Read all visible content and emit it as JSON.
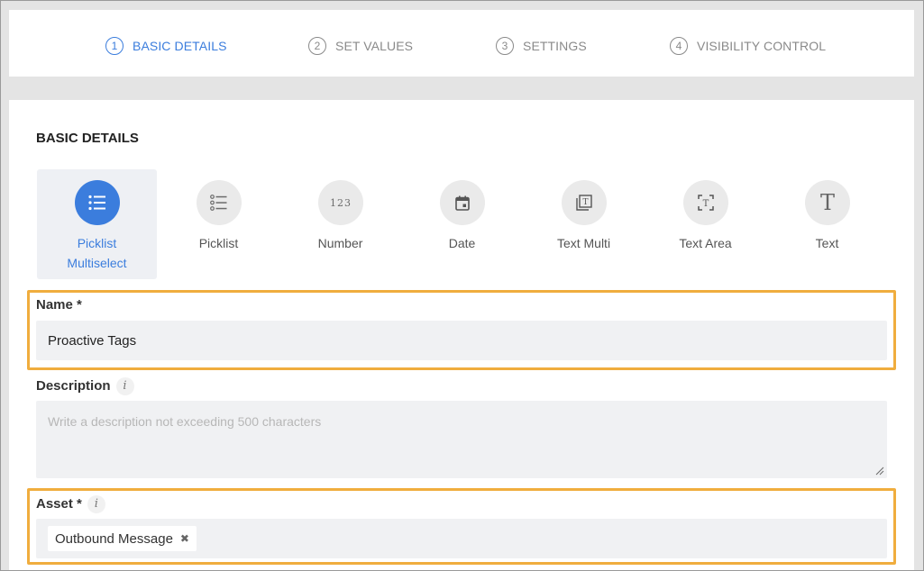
{
  "stepper": {
    "steps": [
      {
        "num": "1",
        "label": "BASIC DETAILS",
        "active": true
      },
      {
        "num": "2",
        "label": "SET VALUES",
        "active": false
      },
      {
        "num": "3",
        "label": "SETTINGS",
        "active": false
      },
      {
        "num": "4",
        "label": "VISIBILITY CONTROL",
        "active": false
      }
    ],
    "accent_color": "#3b7ddd"
  },
  "section": {
    "title": "BASIC DETAILS"
  },
  "field_types": [
    {
      "label_line1": "Picklist",
      "label_line2": "Multiselect",
      "icon": "list-bullets-icon",
      "selected": true
    },
    {
      "label_line1": "Picklist",
      "label_line2": "",
      "icon": "list-radio-icon",
      "selected": false
    },
    {
      "label_line1": "Number",
      "label_line2": "",
      "icon": "number-123-icon",
      "icon_text": "123",
      "selected": false
    },
    {
      "label_line1": "Date",
      "label_line2": "",
      "icon": "calendar-icon",
      "selected": false
    },
    {
      "label_line1": "Text Multi",
      "label_line2": "",
      "icon": "text-multi-icon",
      "selected": false
    },
    {
      "label_line1": "Text Area",
      "label_line2": "",
      "icon": "text-area-icon",
      "selected": false
    },
    {
      "label_line1": "Text",
      "label_line2": "",
      "icon": "text-t-icon",
      "icon_text": "T",
      "selected": false
    }
  ],
  "form": {
    "name": {
      "label": "Name *",
      "value": "Proactive Tags"
    },
    "description": {
      "label": "Description",
      "info": "i",
      "placeholder": "Write a description not exceeding 500 characters"
    },
    "asset": {
      "label": "Asset *",
      "info": "i",
      "tags": [
        "Outbound Message"
      ],
      "remove_glyph": "✖"
    }
  },
  "highlight_color": "#f0ad3e"
}
